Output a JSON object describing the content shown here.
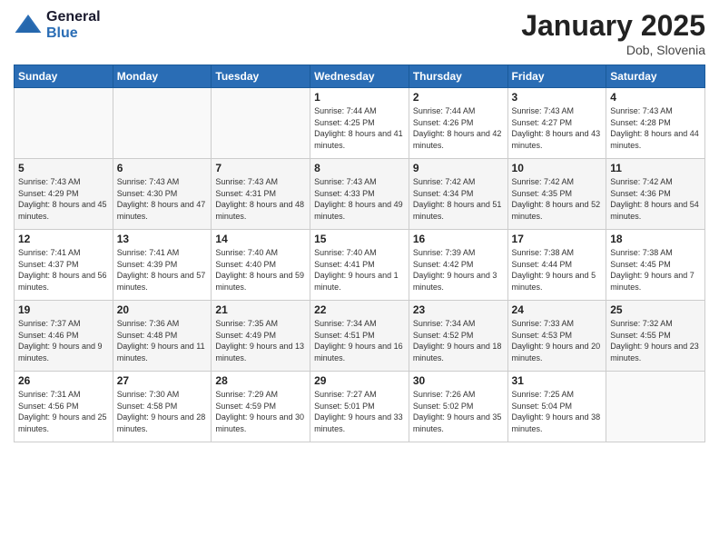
{
  "logo": {
    "line1": "General",
    "line2": "Blue"
  },
  "header": {
    "title": "January 2025",
    "location": "Dob, Slovenia"
  },
  "weekdays": [
    "Sunday",
    "Monday",
    "Tuesday",
    "Wednesday",
    "Thursday",
    "Friday",
    "Saturday"
  ],
  "weeks": [
    [
      {
        "day": "",
        "info": ""
      },
      {
        "day": "",
        "info": ""
      },
      {
        "day": "",
        "info": ""
      },
      {
        "day": "1",
        "info": "Sunrise: 7:44 AM\nSunset: 4:25 PM\nDaylight: 8 hours\nand 41 minutes."
      },
      {
        "day": "2",
        "info": "Sunrise: 7:44 AM\nSunset: 4:26 PM\nDaylight: 8 hours\nand 42 minutes."
      },
      {
        "day": "3",
        "info": "Sunrise: 7:43 AM\nSunset: 4:27 PM\nDaylight: 8 hours\nand 43 minutes."
      },
      {
        "day": "4",
        "info": "Sunrise: 7:43 AM\nSunset: 4:28 PM\nDaylight: 8 hours\nand 44 minutes."
      }
    ],
    [
      {
        "day": "5",
        "info": "Sunrise: 7:43 AM\nSunset: 4:29 PM\nDaylight: 8 hours\nand 45 minutes."
      },
      {
        "day": "6",
        "info": "Sunrise: 7:43 AM\nSunset: 4:30 PM\nDaylight: 8 hours\nand 47 minutes."
      },
      {
        "day": "7",
        "info": "Sunrise: 7:43 AM\nSunset: 4:31 PM\nDaylight: 8 hours\nand 48 minutes."
      },
      {
        "day": "8",
        "info": "Sunrise: 7:43 AM\nSunset: 4:33 PM\nDaylight: 8 hours\nand 49 minutes."
      },
      {
        "day": "9",
        "info": "Sunrise: 7:42 AM\nSunset: 4:34 PM\nDaylight: 8 hours\nand 51 minutes."
      },
      {
        "day": "10",
        "info": "Sunrise: 7:42 AM\nSunset: 4:35 PM\nDaylight: 8 hours\nand 52 minutes."
      },
      {
        "day": "11",
        "info": "Sunrise: 7:42 AM\nSunset: 4:36 PM\nDaylight: 8 hours\nand 54 minutes."
      }
    ],
    [
      {
        "day": "12",
        "info": "Sunrise: 7:41 AM\nSunset: 4:37 PM\nDaylight: 8 hours\nand 56 minutes."
      },
      {
        "day": "13",
        "info": "Sunrise: 7:41 AM\nSunset: 4:39 PM\nDaylight: 8 hours\nand 57 minutes."
      },
      {
        "day": "14",
        "info": "Sunrise: 7:40 AM\nSunset: 4:40 PM\nDaylight: 8 hours\nand 59 minutes."
      },
      {
        "day": "15",
        "info": "Sunrise: 7:40 AM\nSunset: 4:41 PM\nDaylight: 9 hours\nand 1 minute."
      },
      {
        "day": "16",
        "info": "Sunrise: 7:39 AM\nSunset: 4:42 PM\nDaylight: 9 hours\nand 3 minutes."
      },
      {
        "day": "17",
        "info": "Sunrise: 7:38 AM\nSunset: 4:44 PM\nDaylight: 9 hours\nand 5 minutes."
      },
      {
        "day": "18",
        "info": "Sunrise: 7:38 AM\nSunset: 4:45 PM\nDaylight: 9 hours\nand 7 minutes."
      }
    ],
    [
      {
        "day": "19",
        "info": "Sunrise: 7:37 AM\nSunset: 4:46 PM\nDaylight: 9 hours\nand 9 minutes."
      },
      {
        "day": "20",
        "info": "Sunrise: 7:36 AM\nSunset: 4:48 PM\nDaylight: 9 hours\nand 11 minutes."
      },
      {
        "day": "21",
        "info": "Sunrise: 7:35 AM\nSunset: 4:49 PM\nDaylight: 9 hours\nand 13 minutes."
      },
      {
        "day": "22",
        "info": "Sunrise: 7:34 AM\nSunset: 4:51 PM\nDaylight: 9 hours\nand 16 minutes."
      },
      {
        "day": "23",
        "info": "Sunrise: 7:34 AM\nSunset: 4:52 PM\nDaylight: 9 hours\nand 18 minutes."
      },
      {
        "day": "24",
        "info": "Sunrise: 7:33 AM\nSunset: 4:53 PM\nDaylight: 9 hours\nand 20 minutes."
      },
      {
        "day": "25",
        "info": "Sunrise: 7:32 AM\nSunset: 4:55 PM\nDaylight: 9 hours\nand 23 minutes."
      }
    ],
    [
      {
        "day": "26",
        "info": "Sunrise: 7:31 AM\nSunset: 4:56 PM\nDaylight: 9 hours\nand 25 minutes."
      },
      {
        "day": "27",
        "info": "Sunrise: 7:30 AM\nSunset: 4:58 PM\nDaylight: 9 hours\nand 28 minutes."
      },
      {
        "day": "28",
        "info": "Sunrise: 7:29 AM\nSunset: 4:59 PM\nDaylight: 9 hours\nand 30 minutes."
      },
      {
        "day": "29",
        "info": "Sunrise: 7:27 AM\nSunset: 5:01 PM\nDaylight: 9 hours\nand 33 minutes."
      },
      {
        "day": "30",
        "info": "Sunrise: 7:26 AM\nSunset: 5:02 PM\nDaylight: 9 hours\nand 35 minutes."
      },
      {
        "day": "31",
        "info": "Sunrise: 7:25 AM\nSunset: 5:04 PM\nDaylight: 9 hours\nand 38 minutes."
      },
      {
        "day": "",
        "info": ""
      }
    ]
  ]
}
